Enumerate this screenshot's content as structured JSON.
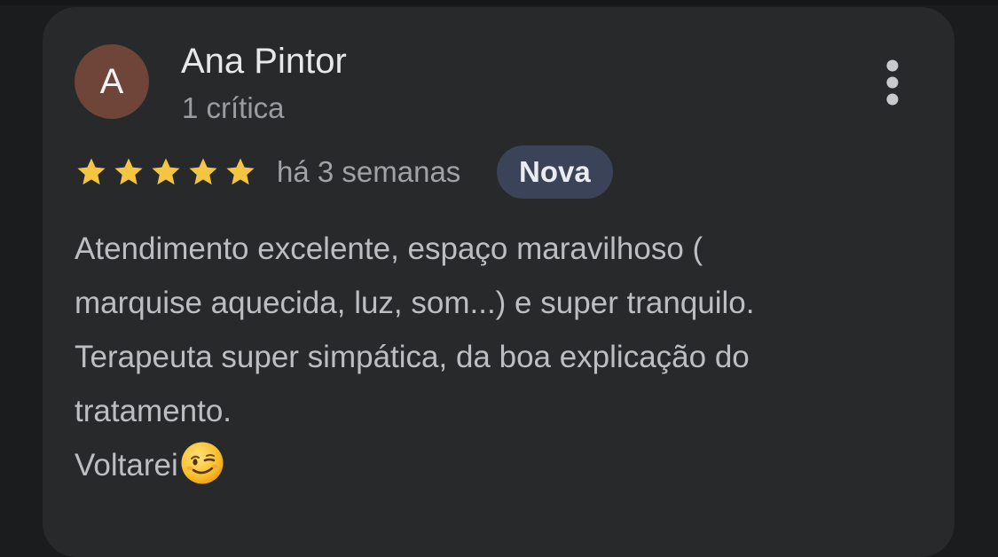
{
  "review": {
    "author": {
      "avatar_letter": "A",
      "avatar_color": "#6e4538",
      "name": "Ana Pintor",
      "meta": "1 crítica"
    },
    "rating": {
      "stars": 5,
      "max": 5,
      "color": "#f4c542"
    },
    "date": "há 3 semanas",
    "badge": "Nova",
    "text_lines": [
      "Atendimento excelente, espaço maravilhoso (",
      "marquise aquecida, luz, som...) e super tranquilo.",
      "Terapeuta super simpática, da boa explicação do",
      "tratamento.",
      "Voltarei"
    ],
    "emoji": "winking-face-emoji",
    "more_icon": "more-vertical-icon"
  },
  "colors": {
    "background": "#1b1c1e",
    "card": "#28292b",
    "badge_bg": "#3a4357"
  }
}
